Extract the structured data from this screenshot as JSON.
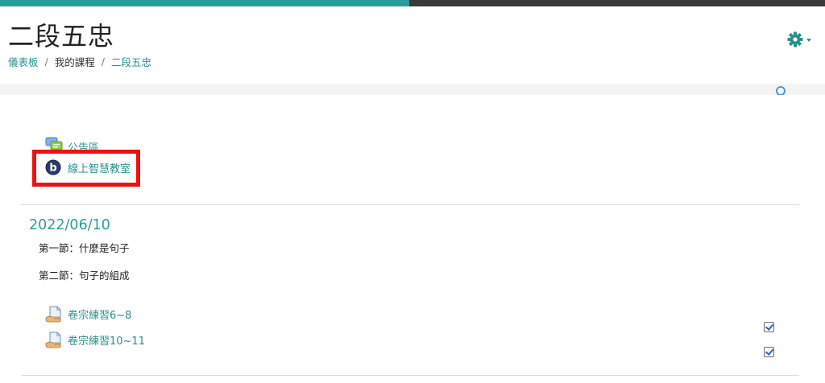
{
  "progress": {
    "fraction": 0.496,
    "fill_color": "#2a9d9a",
    "track_color": "#3a3a3a"
  },
  "header": {
    "title": "二段五忠",
    "breadcrumb": [
      {
        "label": "儀表板",
        "link": true
      },
      {
        "label": "我的課程",
        "link": false
      },
      {
        "label": "二段五忠",
        "link": true
      }
    ],
    "settings_icon": "gear-icon",
    "accent": "#2a8f8c"
  },
  "top_section": {
    "activities": [
      {
        "label": "公告區",
        "icon": "forum-icon"
      },
      {
        "label": "線上智慧教室",
        "icon": "bigbluebutton-icon"
      }
    ]
  },
  "section": {
    "title": "2022/06/10",
    "lines": [
      "第一節：什麼是句子",
      "第二節：句子的組成"
    ],
    "activities": [
      {
        "label": "卷宗練習6~8",
        "icon": "assignment-icon",
        "completed": true
      },
      {
        "label": "卷宗練習10~11",
        "icon": "assignment-icon",
        "completed": true
      }
    ]
  },
  "highlight_color": "#ee1111"
}
